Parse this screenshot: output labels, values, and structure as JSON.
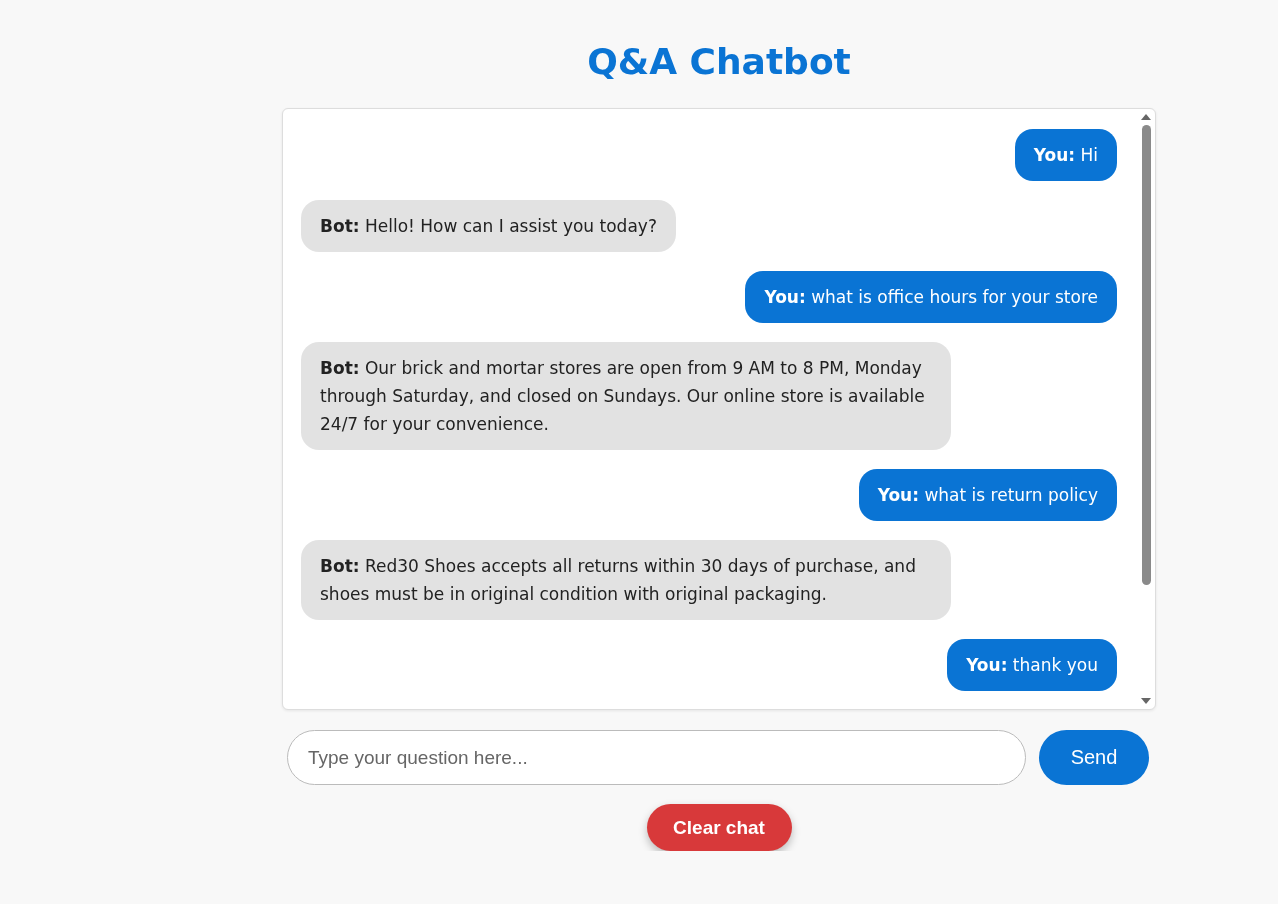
{
  "title": "Q&A Chatbot",
  "messages": [
    {
      "kind": "user",
      "text": "**You:** Hi"
    },
    {
      "kind": "bot",
      "text": "**Bot:** Hello! How can I assist you today?"
    },
    {
      "kind": "user",
      "text": "**You:** what is office hours for your store"
    },
    {
      "kind": "bot",
      "text": "**Bot:** Our brick and mortar stores are open from 9 AM to 8 PM, Monday through Saturday, and closed on Sundays. Our online store is available 24/7 for your convenience."
    },
    {
      "kind": "user",
      "text": "**You:** what is return policy"
    },
    {
      "kind": "bot",
      "text": "**Bot:** Red30 Shoes accepts all returns within 30 days of purchase, and shoes must be in original condition with original packaging."
    },
    {
      "kind": "user",
      "text": "**You:** thank you"
    }
  ],
  "input": {
    "placeholder": "Type your question here..."
  },
  "send_button": "Send",
  "clear_button": "Clear chat"
}
